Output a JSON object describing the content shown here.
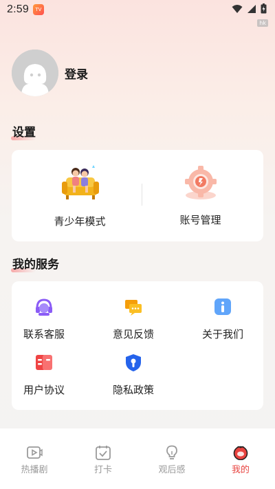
{
  "status_bar": {
    "time": "2:59",
    "badge": "hk"
  },
  "profile": {
    "login_label": "登录"
  },
  "settings": {
    "title": "设置",
    "items": [
      {
        "label": "青少年模式",
        "icon": "teen-mode-couch-icon"
      },
      {
        "label": "账号管理",
        "icon": "account-gear-icon"
      }
    ]
  },
  "services": {
    "title": "我的服务",
    "items": [
      {
        "label": "联系客服",
        "icon": "headset-icon"
      },
      {
        "label": "意见反馈",
        "icon": "feedback-chat-icon"
      },
      {
        "label": "关于我们",
        "icon": "info-icon"
      },
      {
        "label": "用户协议",
        "icon": "agreement-icon"
      },
      {
        "label": "隐私政策",
        "icon": "privacy-shield-icon"
      }
    ]
  },
  "tabbar": {
    "tabs": [
      {
        "label": "热播剧",
        "icon": "video-icon",
        "active": false
      },
      {
        "label": "打卡",
        "icon": "calendar-check-icon",
        "active": false
      },
      {
        "label": "观后感",
        "icon": "lightbulb-icon",
        "active": false
      },
      {
        "label": "我的",
        "icon": "profile-face-icon",
        "active": true
      }
    ]
  },
  "colors": {
    "accent": "#e8433f",
    "icon_purple": "#8b5cf6",
    "icon_orange": "#f59e0b",
    "icon_blue": "#3b82f6",
    "icon_red": "#ef4444"
  }
}
